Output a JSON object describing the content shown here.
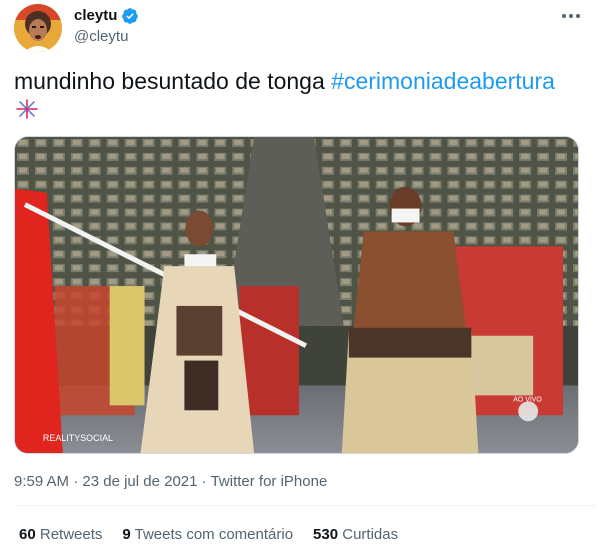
{
  "author": {
    "display_name": "cleytu",
    "handle": "@cleytu",
    "avatar_icon": "avatar-photo",
    "verified_icon": "verified-badge-icon",
    "verified_color": "#1d9bf0"
  },
  "menu_icon": "more-options-icon",
  "tweet": {
    "text": "mundinho besuntado de tonga ",
    "hashtag": "#cerimoniadeabertura",
    "emoji_icon": "fireworks-emoji-icon",
    "hashtag_color": "#1d9bf0"
  },
  "media": {
    "image_icon": "tweet-photo",
    "watermark": "REALITYSOCIAL",
    "live_badge": "AO VIVO"
  },
  "meta": {
    "time": "9:59 AM",
    "separator": " · ",
    "date": "23 de jul de 2021",
    "source": "Twitter for iPhone"
  },
  "stats": {
    "retweets_count": "60",
    "retweets_label": "Retweets",
    "quotes_count": "9",
    "quotes_label": "Tweets com comentário",
    "likes_count": "530",
    "likes_label": "Curtidas"
  }
}
